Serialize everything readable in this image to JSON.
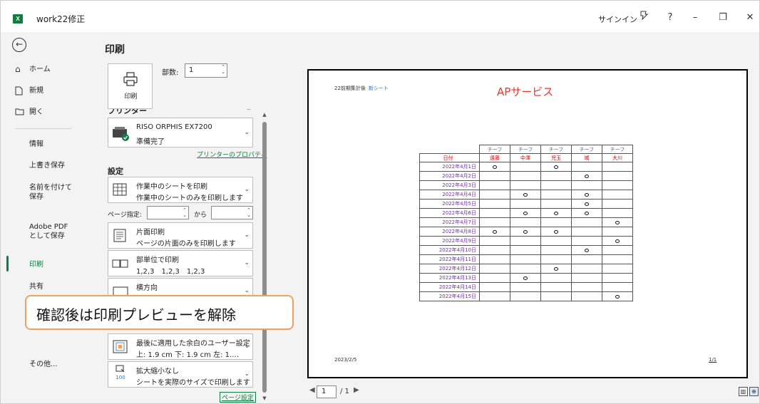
{
  "window": {
    "title": "work22修正",
    "signin": "サインイン",
    "app_icon": "X",
    "controls": {
      "feedback": "feedback-icon",
      "help": "?",
      "minimize": "–",
      "restore": "❐",
      "close": "✕"
    }
  },
  "nav": {
    "back_icon": "back-arrow-icon",
    "items": [
      {
        "label": "ホーム",
        "icon": "⌂"
      },
      {
        "label": "新規",
        "icon": "🗋"
      },
      {
        "label": "開く",
        "icon": "🗀"
      },
      {
        "label": "情報"
      },
      {
        "label": "上書き保存"
      },
      {
        "label": "名前を付けて保存"
      },
      {
        "label": "Adobe PDF として保存"
      },
      {
        "label": "印刷"
      },
      {
        "label": "共有"
      },
      {
        "label": "その他..."
      }
    ],
    "selected": "印刷",
    "accent": "#107c41"
  },
  "print": {
    "title": "印刷",
    "button_label": "印刷",
    "copies_label": "部数:",
    "copies_value": "1",
    "printer_section": "プリンター",
    "printer_name": "RISO ORPHIS EX7200",
    "printer_status": "準備完了",
    "printer_props_link": "プリンターのプロパティ",
    "settings_section": "設定",
    "what": {
      "line1": "作業中のシートを印刷",
      "line2": "作業中のシートのみを印刷します"
    },
    "pages_label": "ページ指定:",
    "pages_to": "から",
    "sides": {
      "line1": "片面印刷",
      "line2": "ページの片面のみを印刷します"
    },
    "collate": {
      "line1": "部単位で印刷",
      "line2": "1,2,3　1,2,3　1,2,3"
    },
    "orientation": {
      "line1": "横方向"
    },
    "margins": {
      "line1": "最後に適用した余白のユーザー設定",
      "line2": "上: 1.9 cm 下: 1.9 cm 左: 1.…"
    },
    "scaling": {
      "line1": "拡大縮小なし",
      "line2": "シートを実際のサイズで印刷します",
      "icon_text": "100"
    },
    "page_setup_link": "ページ設定"
  },
  "callout": "確認後は印刷プレビューを解除",
  "preview": {
    "header_left": "22前期集計後",
    "header_left_tag": "新シート",
    "header_title": "APサービス",
    "footer_date": "2023/2/5",
    "footer_page": "1/1",
    "team_label": "チーフ",
    "date_header": "日付",
    "names": [
      "遠藤",
      "中澤",
      "児玉",
      "城",
      "大川"
    ],
    "rows": [
      {
        "date": "2022年4月1日",
        "marks": [
          1,
          0,
          1,
          0,
          0
        ]
      },
      {
        "date": "2022年4月2日",
        "marks": [
          0,
          0,
          0,
          1,
          0
        ]
      },
      {
        "date": "2022年4月3日",
        "marks": [
          0,
          0,
          0,
          0,
          0
        ]
      },
      {
        "date": "2022年4月4日",
        "marks": [
          0,
          1,
          0,
          1,
          0
        ]
      },
      {
        "date": "2022年4月5日",
        "marks": [
          0,
          0,
          0,
          1,
          0
        ]
      },
      {
        "date": "2022年4月6日",
        "marks": [
          0,
          1,
          1,
          1,
          0
        ]
      },
      {
        "date": "2022年4月7日",
        "marks": [
          0,
          0,
          0,
          0,
          1
        ]
      },
      {
        "date": "2022年4月8日",
        "marks": [
          1,
          1,
          1,
          0,
          0
        ]
      },
      {
        "date": "2022年4月9日",
        "marks": [
          0,
          0,
          0,
          0,
          1
        ]
      },
      {
        "date": "2022年4月10日",
        "marks": [
          0,
          0,
          0,
          1,
          0
        ]
      },
      {
        "date": "2022年4月11日",
        "marks": [
          0,
          0,
          0,
          0,
          0
        ]
      },
      {
        "date": "2022年4月12日",
        "marks": [
          0,
          0,
          1,
          0,
          0
        ]
      },
      {
        "date": "2022年4月13日",
        "marks": [
          0,
          1,
          0,
          0,
          0
        ]
      },
      {
        "date": "2022年4月14日",
        "marks": [
          0,
          0,
          0,
          0,
          0
        ]
      },
      {
        "date": "2022年4月15日",
        "marks": [
          0,
          0,
          0,
          0,
          1
        ]
      }
    ],
    "page_current": "1",
    "page_total": "/ 1"
  }
}
